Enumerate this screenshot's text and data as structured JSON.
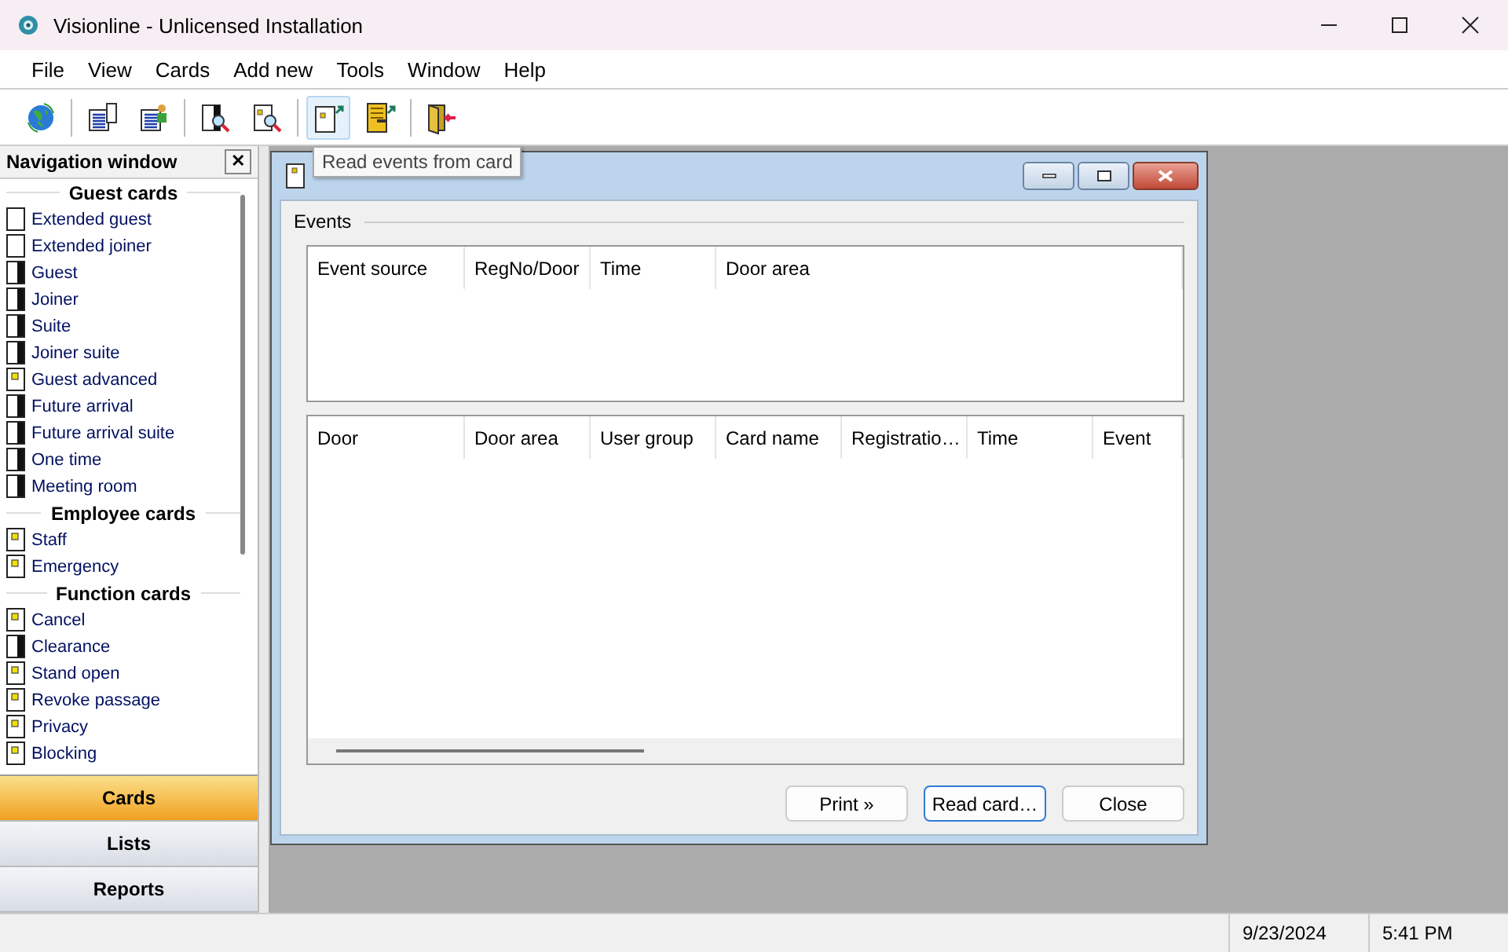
{
  "window": {
    "title": "Visionline - Unlicensed Installation"
  },
  "menu": [
    "File",
    "View",
    "Cards",
    "Add new",
    "Tools",
    "Window",
    "Help"
  ],
  "toolbar": [
    {
      "kind": "globe",
      "highlighted": false,
      "separator_after": true
    },
    {
      "kind": "list",
      "highlighted": false,
      "separator_after": false
    },
    {
      "kind": "list-person",
      "highlighted": false,
      "separator_after": true
    },
    {
      "kind": "card-search",
      "highlighted": false,
      "separator_after": false
    },
    {
      "kind": "chip-search",
      "highlighted": false,
      "separator_after": true
    },
    {
      "kind": "card-arrow",
      "highlighted": true,
      "separator_after": false
    },
    {
      "kind": "door-arrow",
      "highlighted": false,
      "separator_after": true
    },
    {
      "kind": "door-exit",
      "highlighted": false,
      "separator_after": false
    }
  ],
  "tooltip": "Read events from card",
  "navigation": {
    "title": "Navigation window",
    "close": "✕",
    "sections": [
      {
        "title": "Guest cards",
        "items": [
          {
            "label": "Extended guest",
            "kind": "blank"
          },
          {
            "label": "Extended joiner",
            "kind": "blank"
          },
          {
            "label": "Guest",
            "kind": "bar"
          },
          {
            "label": "Joiner",
            "kind": "bar"
          },
          {
            "label": "Suite",
            "kind": "bar"
          },
          {
            "label": "Joiner suite",
            "kind": "bar"
          },
          {
            "label": "Guest advanced",
            "kind": "chip"
          },
          {
            "label": "Future arrival",
            "kind": "bar"
          },
          {
            "label": "Future arrival suite",
            "kind": "bar"
          },
          {
            "label": "One time",
            "kind": "bar"
          },
          {
            "label": "Meeting room",
            "kind": "bar"
          }
        ]
      },
      {
        "title": "Employee cards",
        "items": [
          {
            "label": "Staff",
            "kind": "chip"
          },
          {
            "label": "Emergency",
            "kind": "chip"
          }
        ]
      },
      {
        "title": "Function cards",
        "items": [
          {
            "label": "Cancel",
            "kind": "chip"
          },
          {
            "label": "Clearance",
            "kind": "bar"
          },
          {
            "label": "Stand open",
            "kind": "chip"
          },
          {
            "label": "Revoke passage",
            "kind": "chip"
          },
          {
            "label": "Privacy",
            "kind": "chip"
          },
          {
            "label": "Blocking",
            "kind": "chip"
          }
        ]
      }
    ],
    "tabs": [
      {
        "label": "Cards",
        "selected": true
      },
      {
        "label": "Lists",
        "selected": false
      },
      {
        "label": "Reports",
        "selected": false
      }
    ]
  },
  "dialog": {
    "group": "Events",
    "events_table": {
      "columns": [
        "Event source",
        "RegNo/Door",
        "Time",
        "Door area"
      ]
    },
    "details_table": {
      "columns": [
        "Door",
        "Door area",
        "User group",
        "Card name",
        "Registratio…",
        "Time",
        "Event"
      ]
    },
    "buttons": [
      {
        "label": "Print »",
        "focused": false
      },
      {
        "label": "Read card…",
        "focused": true
      },
      {
        "label": "Close",
        "focused": false
      }
    ]
  },
  "status_bar": {
    "date": "9/23/2024",
    "time": "5:41 PM"
  }
}
